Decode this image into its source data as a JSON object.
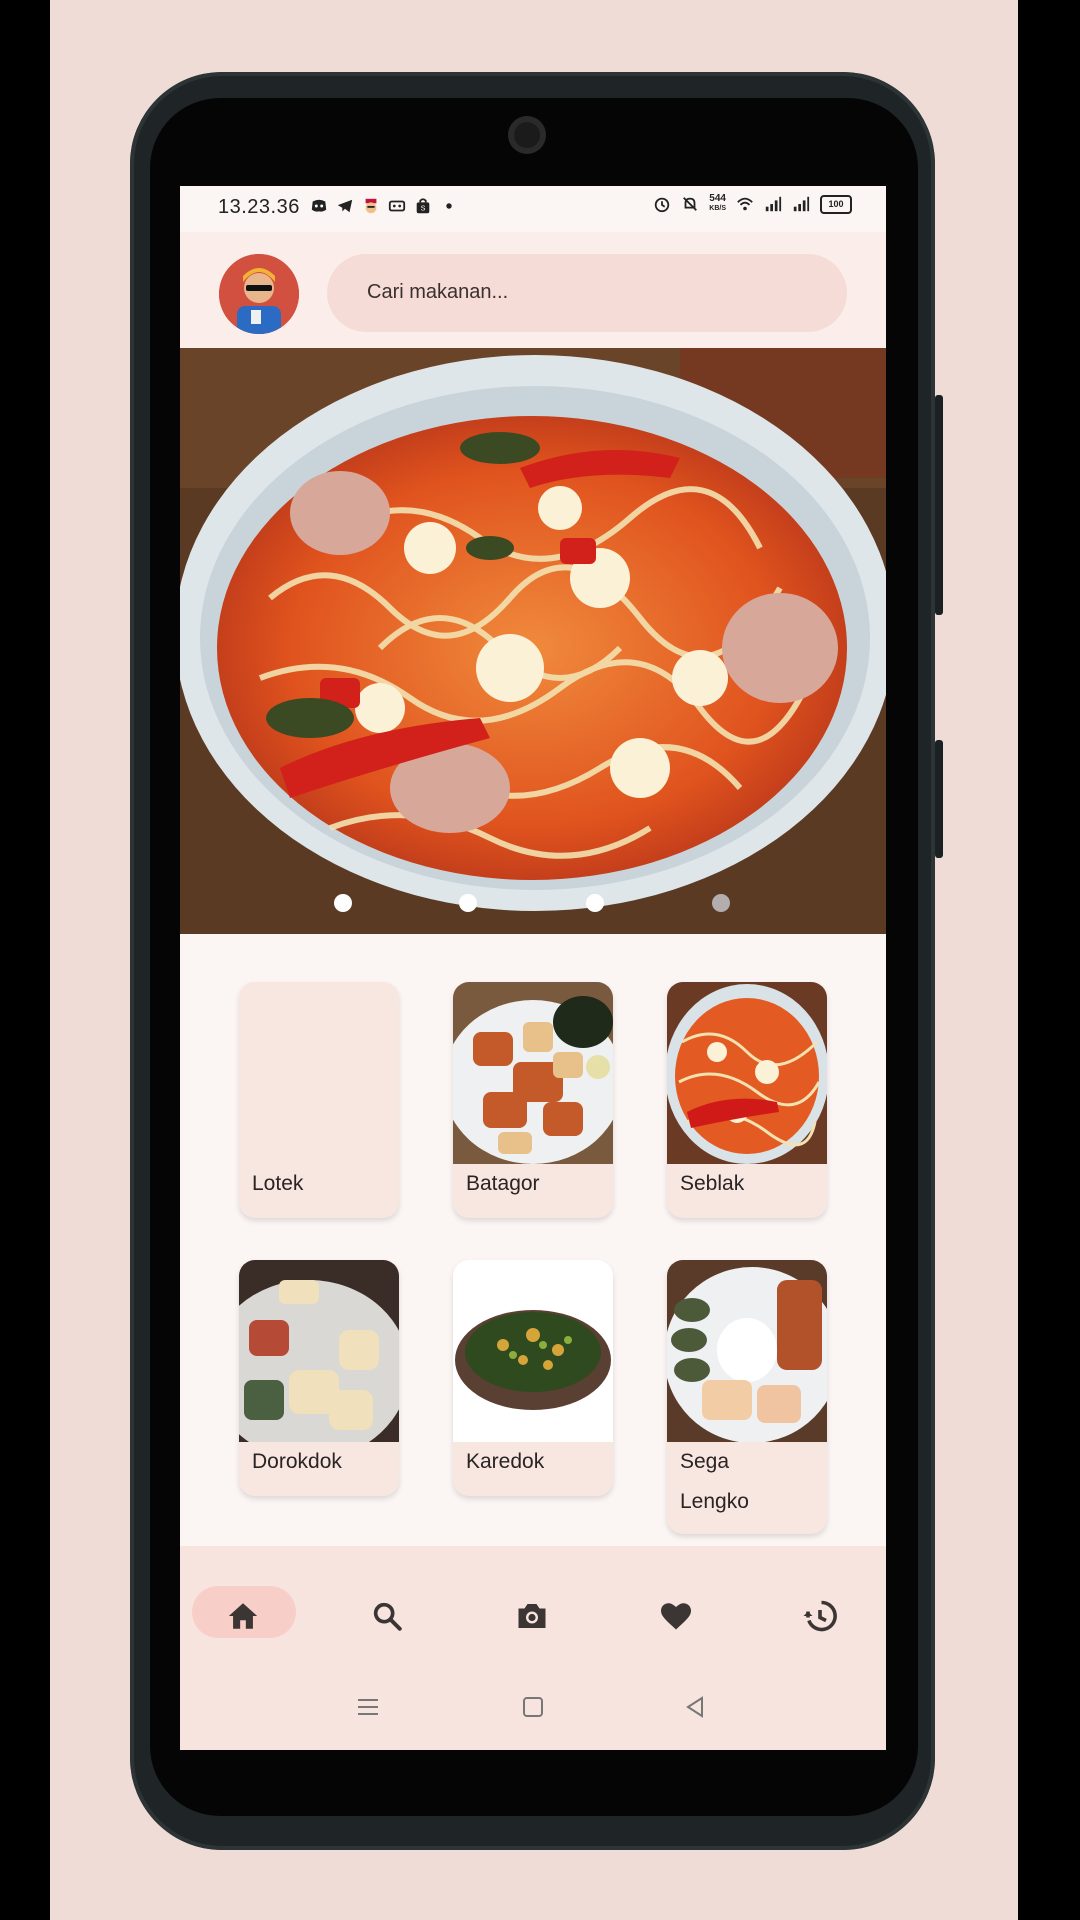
{
  "status_bar": {
    "time": "13.23.36",
    "net_speed_value": "544",
    "net_speed_unit": "KB/S",
    "battery": "100"
  },
  "header": {
    "search_placeholder": "Cari makanan..."
  },
  "carousel": {
    "slide_count": 4,
    "active_index": 0
  },
  "foods": [
    {
      "name": "Lotek"
    },
    {
      "name": "Batagor"
    },
    {
      "name": "Seblak"
    },
    {
      "name": "Dorokdok"
    },
    {
      "name": "Karedok"
    },
    {
      "name": "Sega\nLengko"
    }
  ],
  "bottom_nav": {
    "items": [
      "home-icon",
      "search-icon",
      "camera-icon",
      "heart-icon",
      "history-icon"
    ],
    "active": "home-icon"
  },
  "colors": {
    "accent": "#f7cfc8",
    "icon": "#3b3533"
  }
}
